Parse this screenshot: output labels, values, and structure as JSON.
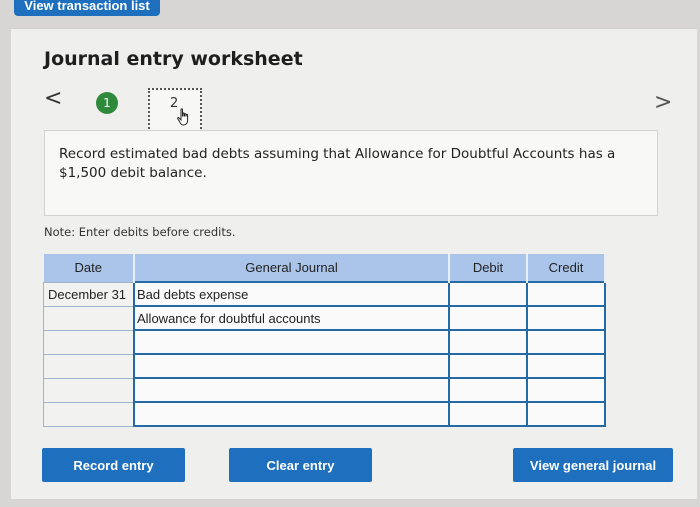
{
  "header": {
    "tab_label": "View transaction list"
  },
  "worksheet": {
    "title": "Journal entry worksheet",
    "nav": {
      "prev": "<",
      "next": ">"
    },
    "steps": [
      {
        "label": "1"
      },
      {
        "label": "2"
      }
    ],
    "instruction": "Record estimated bad debts assuming that Allowance for Doubtful Accounts has a $1,500 debit balance.",
    "note": "Note: Enter debits before credits."
  },
  "journal": {
    "headers": {
      "date": "Date",
      "account": "General Journal",
      "debit": "Debit",
      "credit": "Credit"
    },
    "rows": [
      {
        "date": "December 31",
        "account": "Bad debts expense",
        "debit": "",
        "credit": ""
      },
      {
        "date": "",
        "account": "Allowance for doubtful accounts",
        "debit": "",
        "credit": ""
      },
      {
        "date": "",
        "account": "",
        "debit": "",
        "credit": ""
      },
      {
        "date": "",
        "account": "",
        "debit": "",
        "credit": ""
      },
      {
        "date": "",
        "account": "",
        "debit": "",
        "credit": ""
      },
      {
        "date": "",
        "account": "",
        "debit": "",
        "credit": ""
      }
    ]
  },
  "buttons": {
    "record": "Record entry",
    "clear": "Clear entry",
    "view": "View general journal"
  },
  "colors": {
    "accent": "#1f6fbf",
    "step_complete": "#2e8a3a",
    "table_header": "#aac5e9"
  },
  "icons": {
    "cursor": "hand-pointer-icon"
  }
}
